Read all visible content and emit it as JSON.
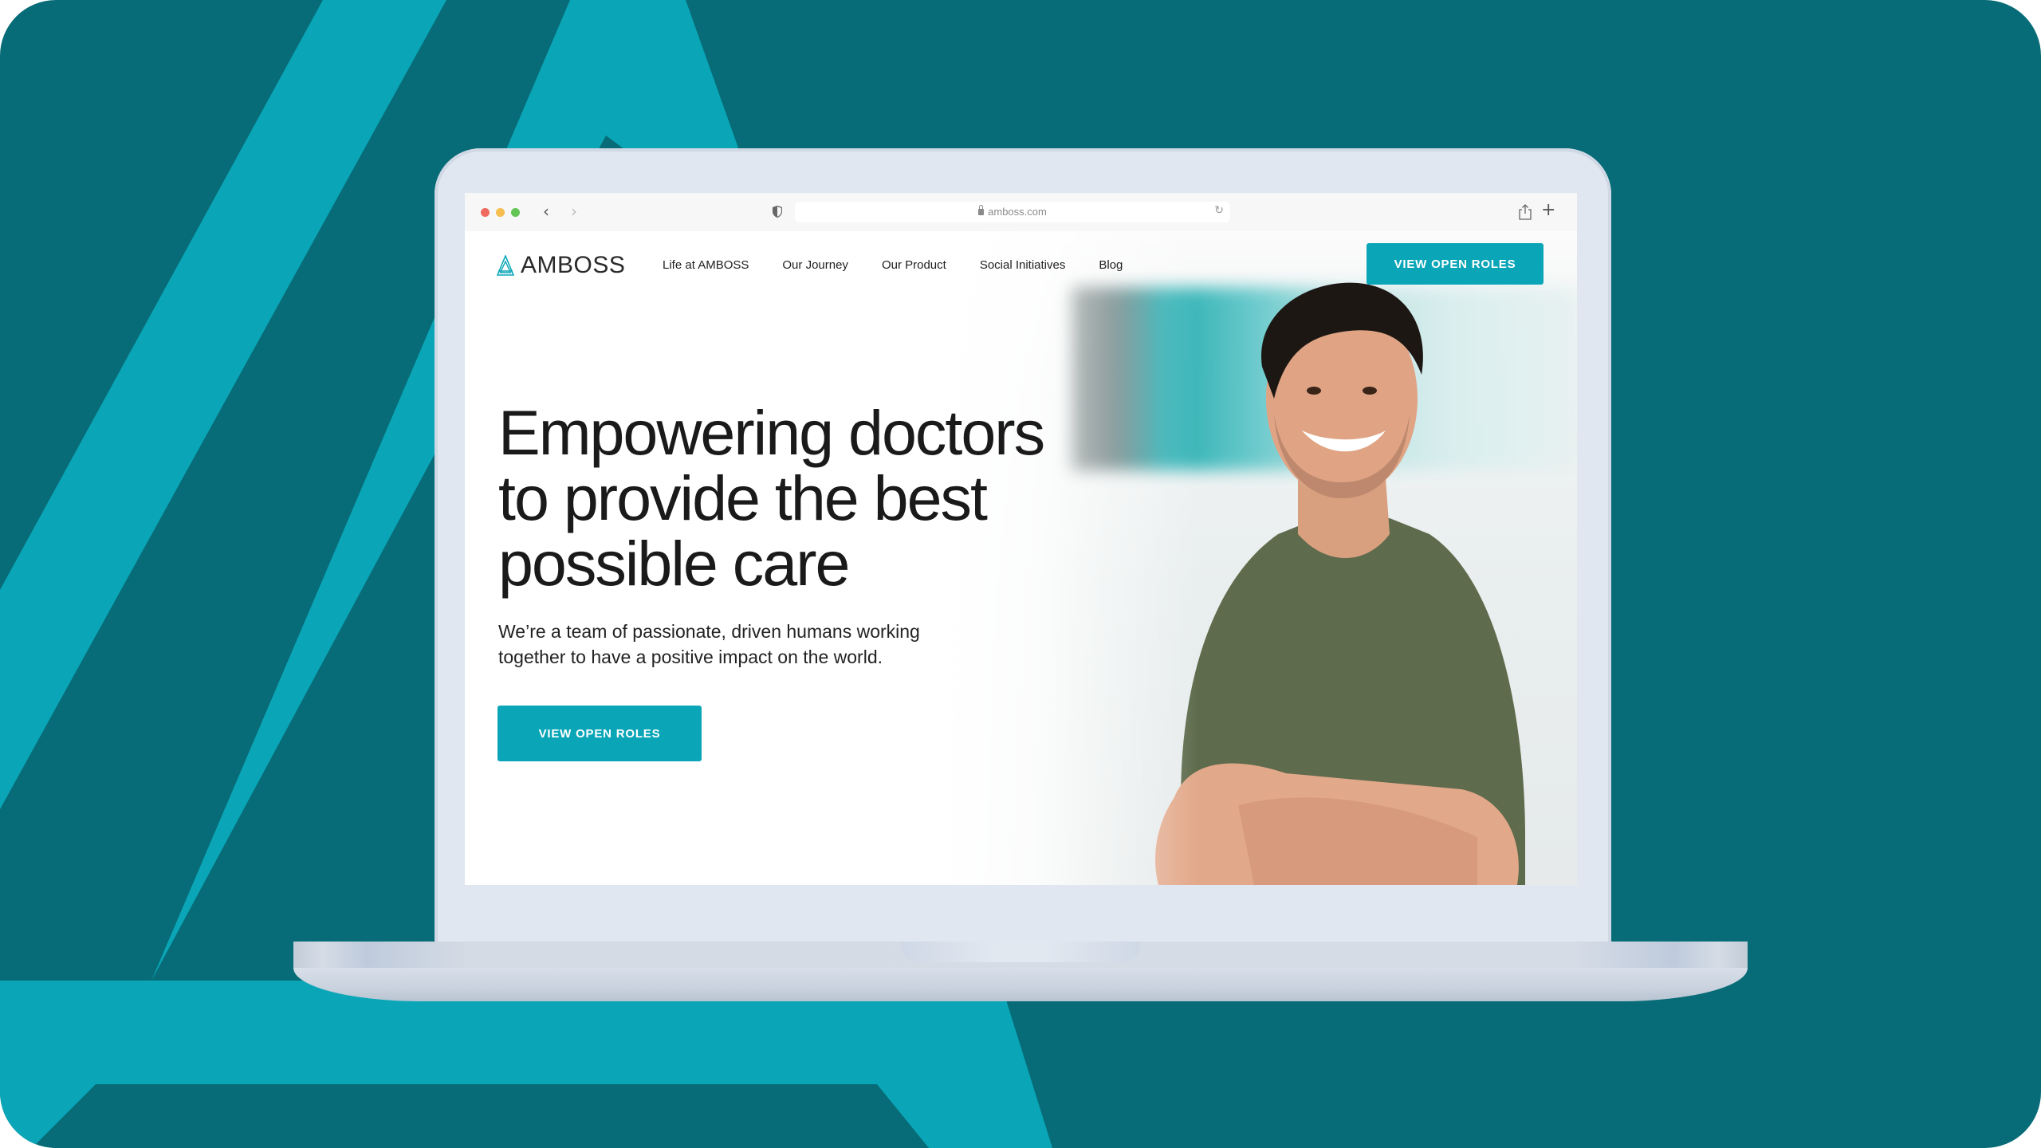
{
  "colors": {
    "background_dark": "#076c77",
    "background_light": "#0aa6b8",
    "accent": "#0aa6b8",
    "laptop": "#e0e7f0"
  },
  "browser": {
    "url": "amboss.com",
    "traffic_lights": [
      "close",
      "minimize",
      "zoom"
    ],
    "icons": {
      "back": "chevron-left-icon",
      "forward": "chevron-right-icon",
      "privacy": "shield-icon",
      "lock": "lock-icon",
      "reload": "reload-icon",
      "share": "share-icon",
      "new_tab": "plus-icon"
    },
    "glyphs": {
      "back": "‹",
      "forward": "›",
      "reload": "↻",
      "new_tab": "+"
    }
  },
  "site": {
    "brand": "AMBOSS",
    "nav": [
      {
        "label": "Life at AMBOSS"
      },
      {
        "label": "Our Journey"
      },
      {
        "label": "Our Product"
      },
      {
        "label": "Social Initiatives"
      },
      {
        "label": "Blog"
      }
    ],
    "header_cta": "VIEW OPEN ROLES",
    "hero": {
      "headline_lines": [
        "Empowering doctors",
        "to provide the best",
        "possible care"
      ],
      "subtext_lines": [
        "We’re a team of passionate, driven humans working",
        "together to have a positive impact on the world."
      ],
      "cta": "VIEW OPEN ROLES",
      "image": "smiling man in olive t-shirt with arms crossed"
    }
  }
}
